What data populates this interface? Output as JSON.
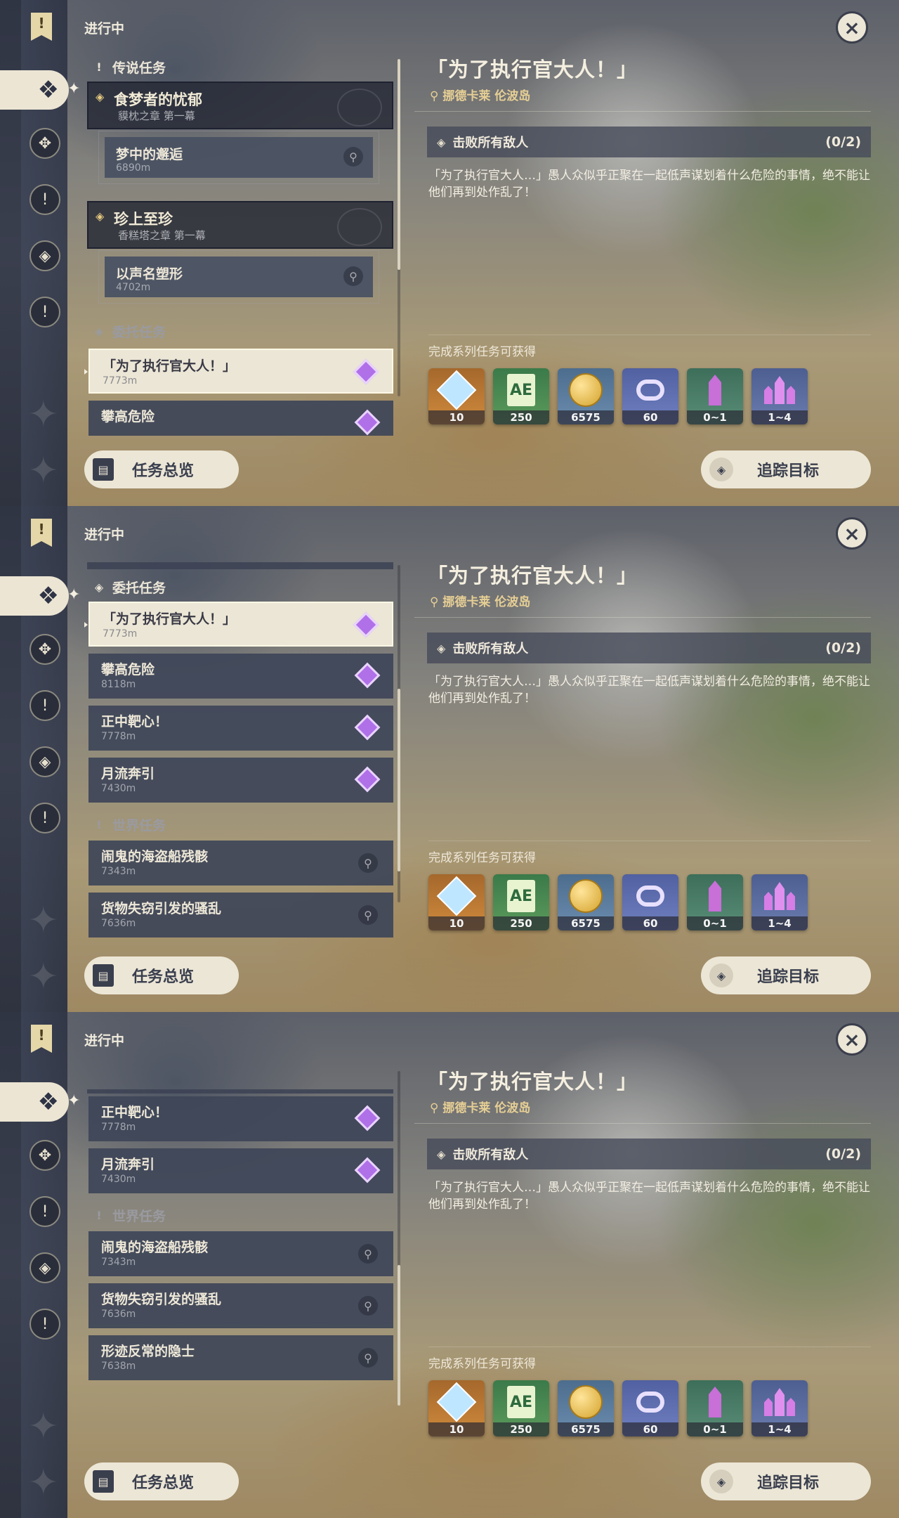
{
  "status": "进行中",
  "close_icon": "×",
  "categories": {
    "legend": "传说任务",
    "commission": "委托任务",
    "world": "世界任务"
  },
  "legend_groups": [
    {
      "title": "食梦者的忧郁",
      "subtitle": "貘枕之章 第一幕",
      "sub": {
        "title": "梦中的邂逅",
        "distance": "6890m"
      }
    },
    {
      "title": "珍上至珍",
      "subtitle": "香糕塔之章 第一幕",
      "sub": {
        "title": "以声名塑形",
        "distance": "4702m"
      }
    }
  ],
  "commissions": [
    {
      "title": "「为了执行官大人！」",
      "distance": "7773m"
    },
    {
      "title": "攀高危险",
      "distance": "8118m"
    },
    {
      "title": "正中靶心！",
      "distance": "7778m"
    },
    {
      "title": "月流奔引",
      "distance": "7430m"
    }
  ],
  "world_quests": [
    {
      "title": "闹鬼的海盗船残骸",
      "distance": "7343m"
    },
    {
      "title": "货物失窃引发的骚乱",
      "distance": "7636m"
    },
    {
      "title": "形迹反常的隐士",
      "distance": "7638m"
    }
  ],
  "buttons": {
    "overview": "任务总览",
    "track": "追踪目标"
  },
  "detail": {
    "title": "「为了执行官大人！」",
    "location": "挪德卡莱 伦波岛",
    "objective": "击败所有敌人",
    "progress": "(0/2)",
    "description": "「为了执行官大人…」愚人众似乎正聚在一起低声谋划着什么危险的事情，绝不能让他们再到处作乱了！",
    "rewards_header": "完成系列任务可获得",
    "rewards": [
      {
        "icon": "primogem-icon",
        "count": "10"
      },
      {
        "icon": "adventure-exp-icon",
        "count": "250"
      },
      {
        "icon": "mora-icon",
        "count": "6575"
      },
      {
        "icon": "companionship-exp-icon",
        "count": "60"
      },
      {
        "icon": "crystal-chunk-icon",
        "count": "0~1"
      },
      {
        "icon": "crystal-cluster-icon",
        "count": "1~4"
      }
    ]
  },
  "icons": {
    "pin": "⚲",
    "star": "star-icon",
    "diamond": "◈",
    "overview": "▤",
    "track": "◈"
  }
}
